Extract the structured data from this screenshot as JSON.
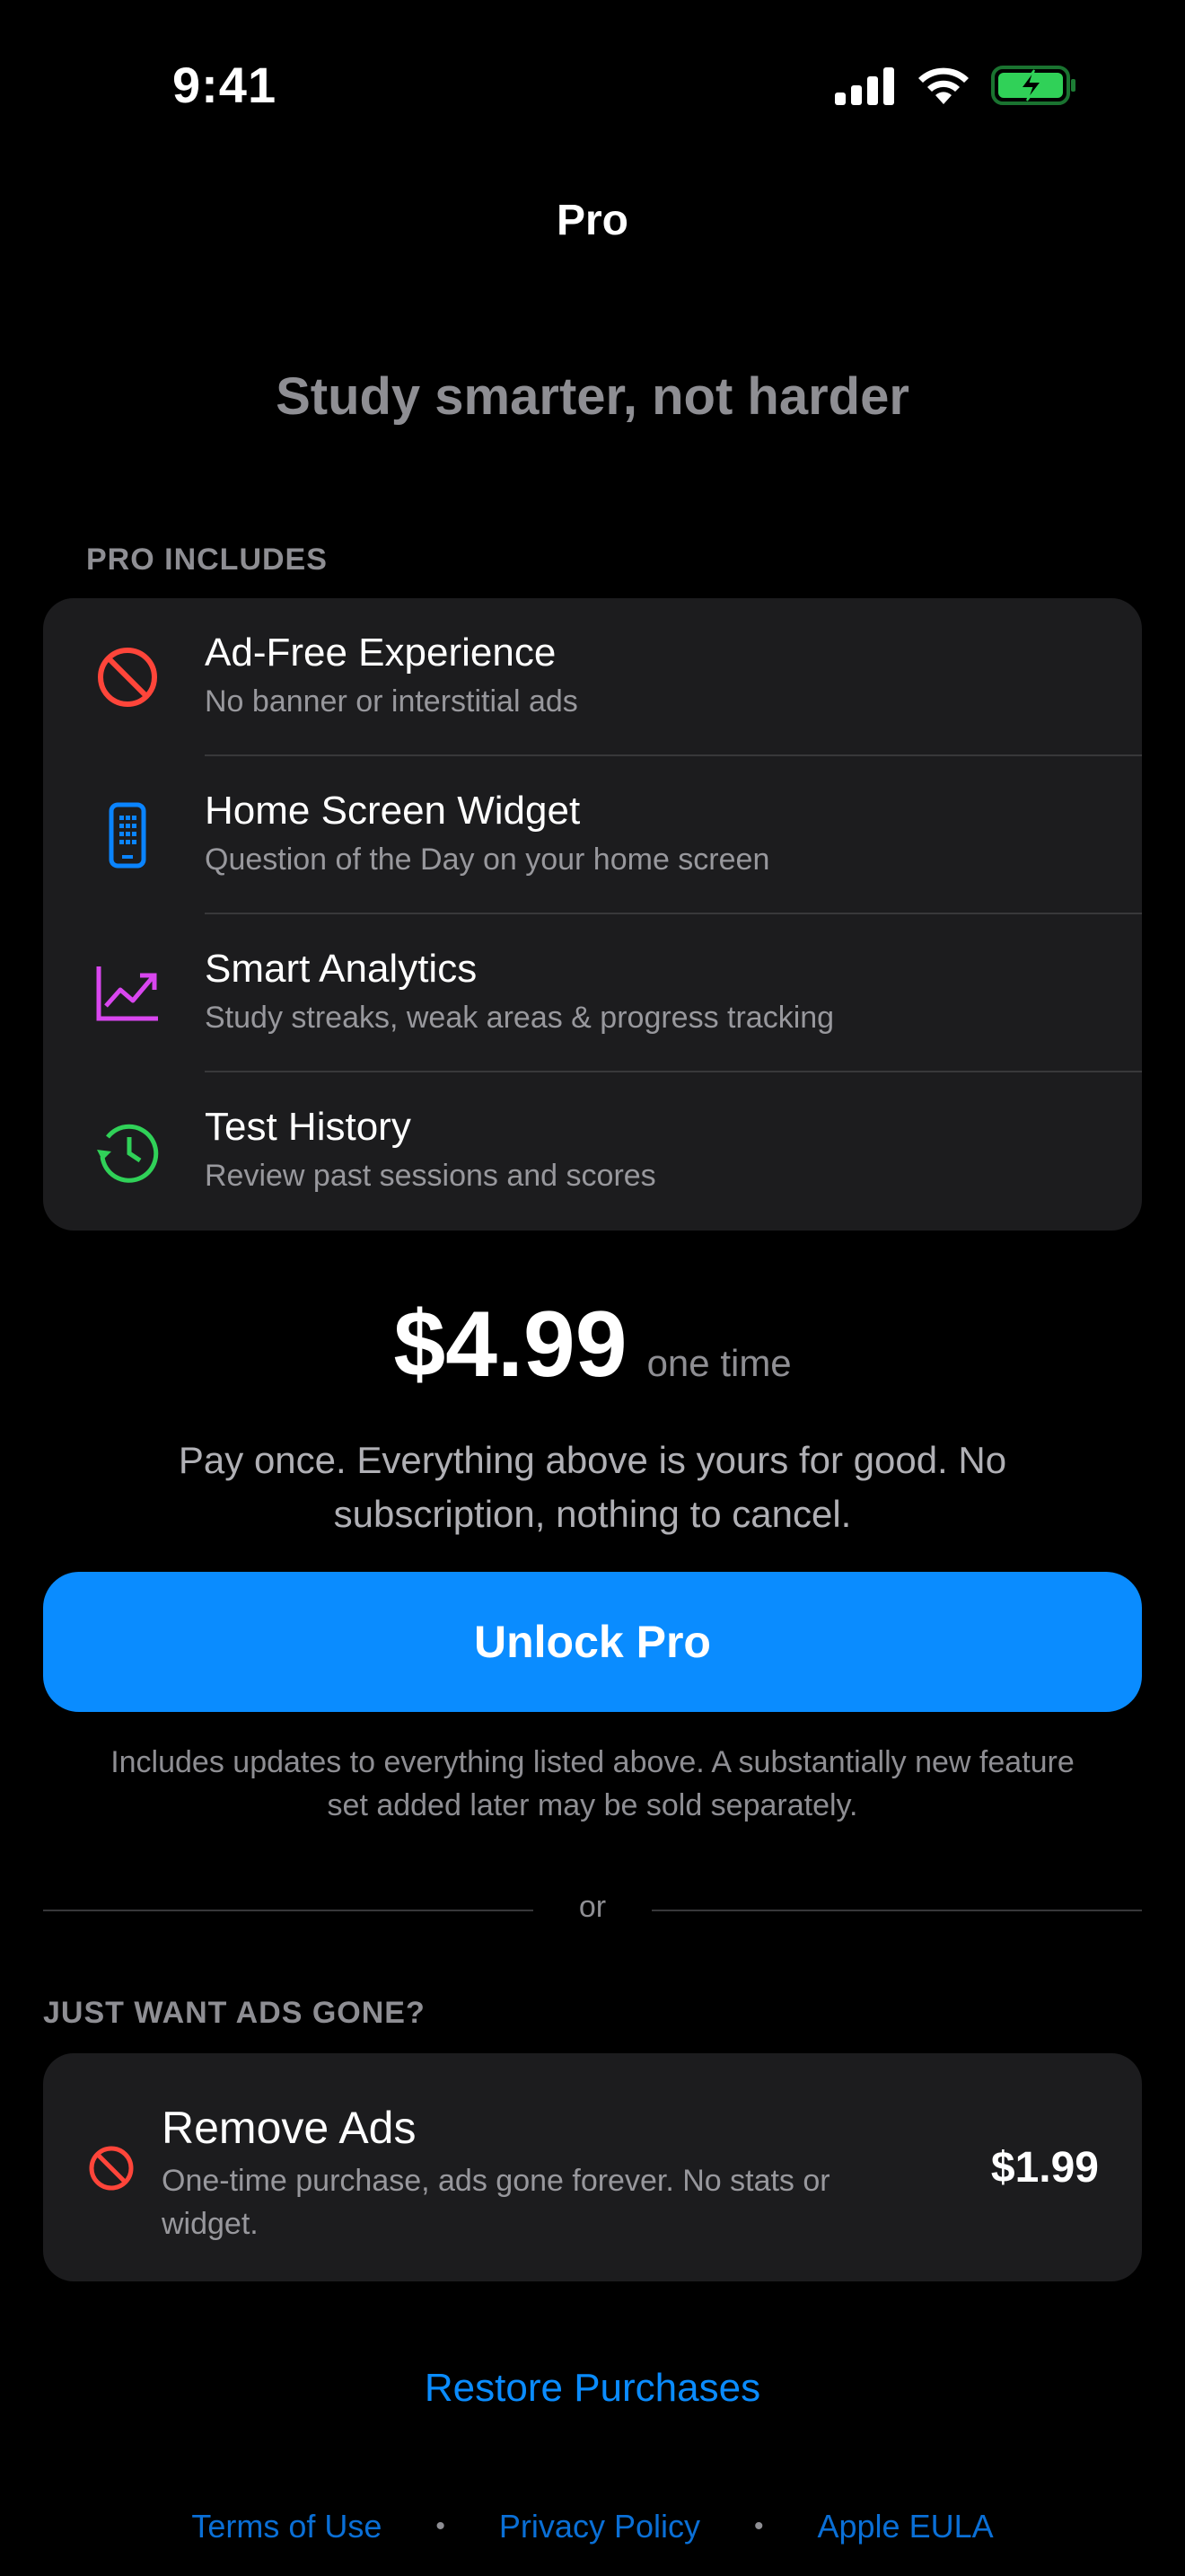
{
  "status_bar": {
    "time": "9:41"
  },
  "nav": {
    "title": "Pro"
  },
  "tagline": "Study smarter, not harder",
  "pro_includes": {
    "header": "PRO INCLUDES",
    "features": [
      {
        "title": "Ad-Free Experience",
        "subtitle": "No banner or interstitial ads",
        "icon": "no-ads-icon",
        "color": "#ff453a"
      },
      {
        "title": "Home Screen Widget",
        "subtitle": "Question of the Day on your home screen",
        "icon": "widget-phone-icon",
        "color": "#0a84ff"
      },
      {
        "title": "Smart Analytics",
        "subtitle": "Study streaks, weak areas & progress tracking",
        "icon": "chart-trend-icon",
        "color": "#d946ef"
      },
      {
        "title": "Test History",
        "subtitle": "Review past sessions and scores",
        "icon": "history-clock-icon",
        "color": "#30d158"
      }
    ]
  },
  "pricing": {
    "amount": "$4.99",
    "suffix": "one time",
    "description": "Pay once. Everything above is yours for good. No subscription, nothing to cancel.",
    "button_label": "Unlock Pro",
    "fineprint": "Includes updates to everything listed above. A substantially new feature set added later may be sold separately."
  },
  "divider_text": "or",
  "remove_ads": {
    "header": "JUST WANT ADS GONE?",
    "title": "Remove Ads",
    "subtitle": "One-time purchase, ads gone forever. No stats or widget.",
    "price": "$1.99",
    "icon": "no-ads-icon"
  },
  "restore_label": "Restore Purchases",
  "footer": {
    "links": [
      "Terms of Use",
      "Privacy Policy",
      "Apple EULA"
    ]
  },
  "colors": {
    "accent": "#0a8cff",
    "card_bg": "#1c1c1e",
    "battery": "#30d158"
  }
}
